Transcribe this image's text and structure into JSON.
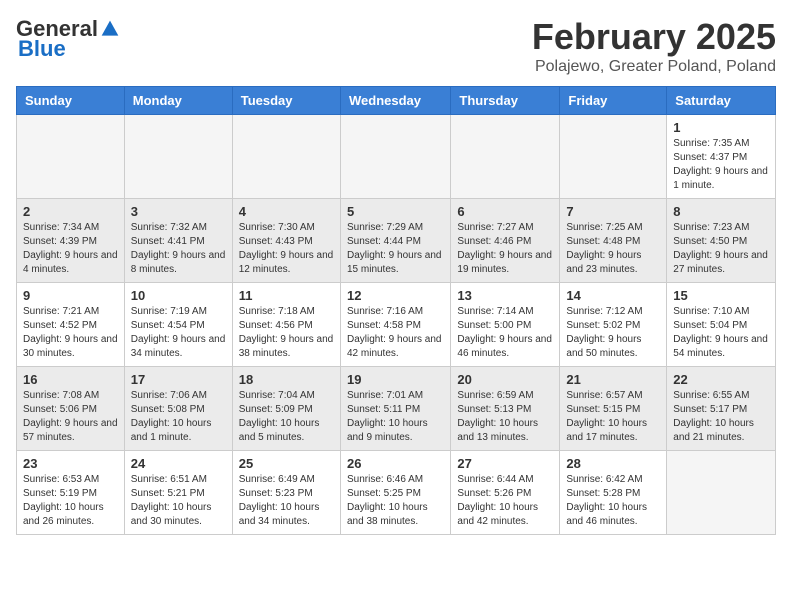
{
  "header": {
    "logo_general": "General",
    "logo_blue": "Blue",
    "main_title": "February 2025",
    "subtitle": "Polajewo, Greater Poland, Poland"
  },
  "weekdays": [
    "Sunday",
    "Monday",
    "Tuesday",
    "Wednesday",
    "Thursday",
    "Friday",
    "Saturday"
  ],
  "weeks": [
    {
      "shaded": false,
      "days": [
        {
          "num": "",
          "info": ""
        },
        {
          "num": "",
          "info": ""
        },
        {
          "num": "",
          "info": ""
        },
        {
          "num": "",
          "info": ""
        },
        {
          "num": "",
          "info": ""
        },
        {
          "num": "",
          "info": ""
        },
        {
          "num": "1",
          "info": "Sunrise: 7:35 AM\nSunset: 4:37 PM\nDaylight: 9 hours and 1 minute."
        }
      ]
    },
    {
      "shaded": true,
      "days": [
        {
          "num": "2",
          "info": "Sunrise: 7:34 AM\nSunset: 4:39 PM\nDaylight: 9 hours and 4 minutes."
        },
        {
          "num": "3",
          "info": "Sunrise: 7:32 AM\nSunset: 4:41 PM\nDaylight: 9 hours and 8 minutes."
        },
        {
          "num": "4",
          "info": "Sunrise: 7:30 AM\nSunset: 4:43 PM\nDaylight: 9 hours and 12 minutes."
        },
        {
          "num": "5",
          "info": "Sunrise: 7:29 AM\nSunset: 4:44 PM\nDaylight: 9 hours and 15 minutes."
        },
        {
          "num": "6",
          "info": "Sunrise: 7:27 AM\nSunset: 4:46 PM\nDaylight: 9 hours and 19 minutes."
        },
        {
          "num": "7",
          "info": "Sunrise: 7:25 AM\nSunset: 4:48 PM\nDaylight: 9 hours and 23 minutes."
        },
        {
          "num": "8",
          "info": "Sunrise: 7:23 AM\nSunset: 4:50 PM\nDaylight: 9 hours and 27 minutes."
        }
      ]
    },
    {
      "shaded": false,
      "days": [
        {
          "num": "9",
          "info": "Sunrise: 7:21 AM\nSunset: 4:52 PM\nDaylight: 9 hours and 30 minutes."
        },
        {
          "num": "10",
          "info": "Sunrise: 7:19 AM\nSunset: 4:54 PM\nDaylight: 9 hours and 34 minutes."
        },
        {
          "num": "11",
          "info": "Sunrise: 7:18 AM\nSunset: 4:56 PM\nDaylight: 9 hours and 38 minutes."
        },
        {
          "num": "12",
          "info": "Sunrise: 7:16 AM\nSunset: 4:58 PM\nDaylight: 9 hours and 42 minutes."
        },
        {
          "num": "13",
          "info": "Sunrise: 7:14 AM\nSunset: 5:00 PM\nDaylight: 9 hours and 46 minutes."
        },
        {
          "num": "14",
          "info": "Sunrise: 7:12 AM\nSunset: 5:02 PM\nDaylight: 9 hours and 50 minutes."
        },
        {
          "num": "15",
          "info": "Sunrise: 7:10 AM\nSunset: 5:04 PM\nDaylight: 9 hours and 54 minutes."
        }
      ]
    },
    {
      "shaded": true,
      "days": [
        {
          "num": "16",
          "info": "Sunrise: 7:08 AM\nSunset: 5:06 PM\nDaylight: 9 hours and 57 minutes."
        },
        {
          "num": "17",
          "info": "Sunrise: 7:06 AM\nSunset: 5:08 PM\nDaylight: 10 hours and 1 minute."
        },
        {
          "num": "18",
          "info": "Sunrise: 7:04 AM\nSunset: 5:09 PM\nDaylight: 10 hours and 5 minutes."
        },
        {
          "num": "19",
          "info": "Sunrise: 7:01 AM\nSunset: 5:11 PM\nDaylight: 10 hours and 9 minutes."
        },
        {
          "num": "20",
          "info": "Sunrise: 6:59 AM\nSunset: 5:13 PM\nDaylight: 10 hours and 13 minutes."
        },
        {
          "num": "21",
          "info": "Sunrise: 6:57 AM\nSunset: 5:15 PM\nDaylight: 10 hours and 17 minutes."
        },
        {
          "num": "22",
          "info": "Sunrise: 6:55 AM\nSunset: 5:17 PM\nDaylight: 10 hours and 21 minutes."
        }
      ]
    },
    {
      "shaded": false,
      "days": [
        {
          "num": "23",
          "info": "Sunrise: 6:53 AM\nSunset: 5:19 PM\nDaylight: 10 hours and 26 minutes."
        },
        {
          "num": "24",
          "info": "Sunrise: 6:51 AM\nSunset: 5:21 PM\nDaylight: 10 hours and 30 minutes."
        },
        {
          "num": "25",
          "info": "Sunrise: 6:49 AM\nSunset: 5:23 PM\nDaylight: 10 hours and 34 minutes."
        },
        {
          "num": "26",
          "info": "Sunrise: 6:46 AM\nSunset: 5:25 PM\nDaylight: 10 hours and 38 minutes."
        },
        {
          "num": "27",
          "info": "Sunrise: 6:44 AM\nSunset: 5:26 PM\nDaylight: 10 hours and 42 minutes."
        },
        {
          "num": "28",
          "info": "Sunrise: 6:42 AM\nSunset: 5:28 PM\nDaylight: 10 hours and 46 minutes."
        },
        {
          "num": "",
          "info": ""
        }
      ]
    }
  ]
}
